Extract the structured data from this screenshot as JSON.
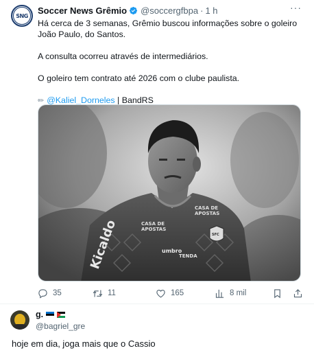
{
  "tweet": {
    "display_name": "Soccer News Grêmio",
    "handle": "@soccergfbpa",
    "separator": "·",
    "time": "1 h",
    "more_label": "···",
    "avatar_initials": "SNG",
    "paragraphs": [
      "Há cerca de 3 semanas, Grêmio buscou informações sobre o goleiro João Paulo, do Santos.",
      "A consulta ocorreu através de intermediários.",
      "O goleiro tem contrato até 2026 com o clube paulista."
    ],
    "credit_icon": "pencil-icon",
    "credit_mention": "@Kaliel_Dorneles",
    "credit_suffix": " | BandRS",
    "media_alt": "Goleiro com camisa de treino do Santos",
    "actions": {
      "replies": "35",
      "retweets": "11",
      "likes": "165",
      "views": "8 mil"
    }
  },
  "reply": {
    "display_name": "g.",
    "handle": "@bagriel_gre",
    "text": "hoje em dia, joga mais que o Cassio"
  },
  "colors": {
    "accent": "#1d9bf0",
    "muted": "#536471",
    "text": "#0f1419"
  }
}
